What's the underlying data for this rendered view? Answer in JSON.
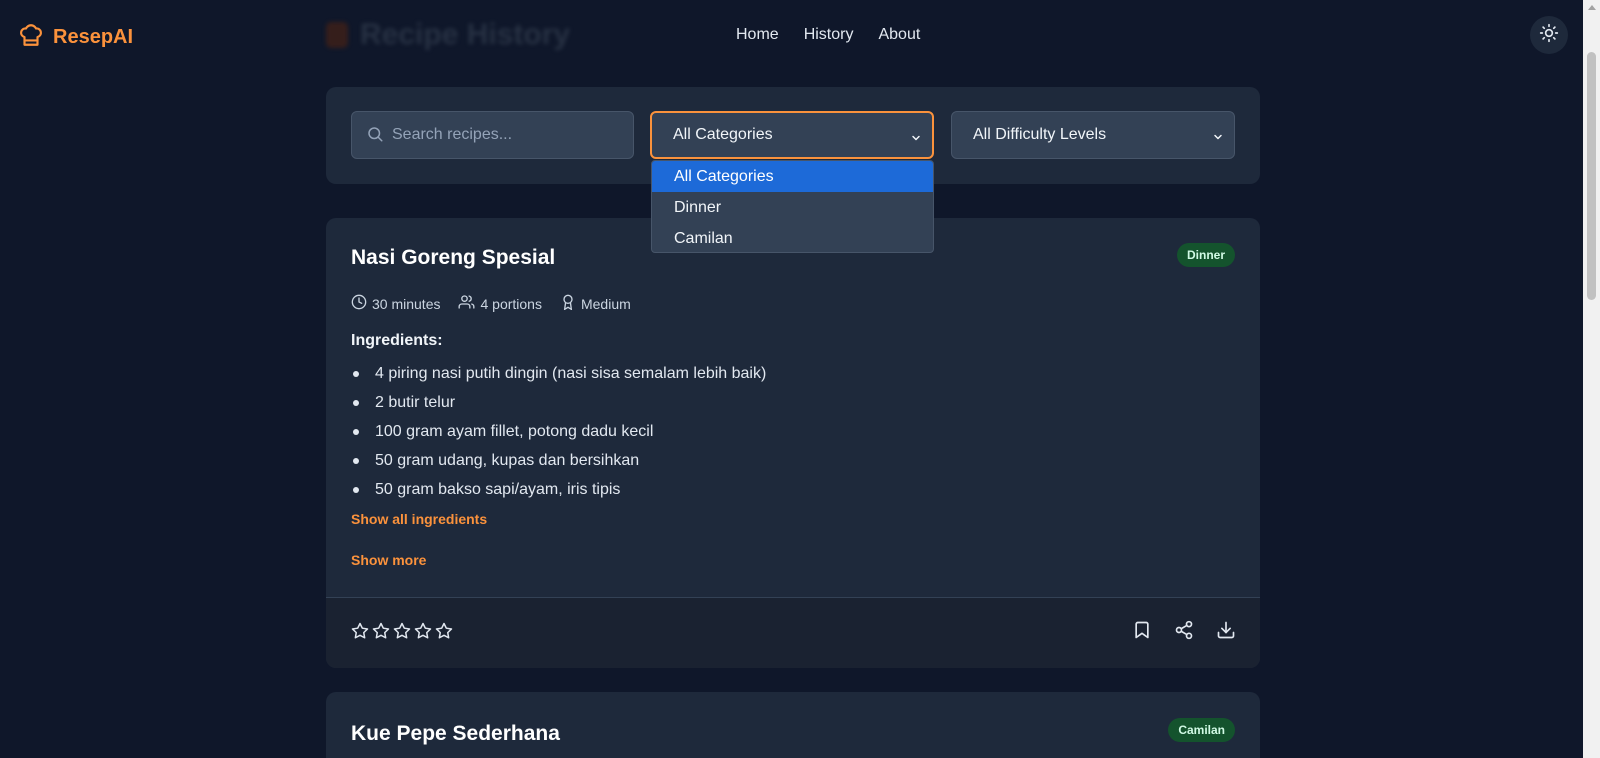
{
  "header": {
    "brand": "ResepAI",
    "page_title": "Recipe History",
    "nav": [
      "Home",
      "History",
      "About"
    ]
  },
  "filters": {
    "search_placeholder": "Search recipes...",
    "category_selected": "All Categories",
    "difficulty_selected": "All Difficulty Levels",
    "category_options": [
      "All Categories",
      "Dinner",
      "Camilan"
    ]
  },
  "recipes": [
    {
      "title": "Nasi Goreng Spesial",
      "category": "Dinner",
      "time": "30 minutes",
      "portions": "4 portions",
      "difficulty": "Medium",
      "ingredients_title": "Ingredients:",
      "ingredients": [
        "4 piring nasi putih dingin (nasi sisa semalam lebih baik)",
        "2 butir telur",
        "100 gram ayam fillet, potong dadu kecil",
        "50 gram udang, kupas dan bersihkan",
        "50 gram bakso sapi/ayam, iris tipis"
      ],
      "show_all_ingredients": "Show all ingredients",
      "show_more": "Show more",
      "rating": 0
    },
    {
      "title": "Kue Pepe Sederhana",
      "category": "Camilan"
    }
  ],
  "colors": {
    "accent": "#fb923c",
    "background": "#0f172a",
    "card": "#1e293b",
    "badge_bg": "#14532d",
    "dropdown_highlight": "#1d6ad8"
  }
}
